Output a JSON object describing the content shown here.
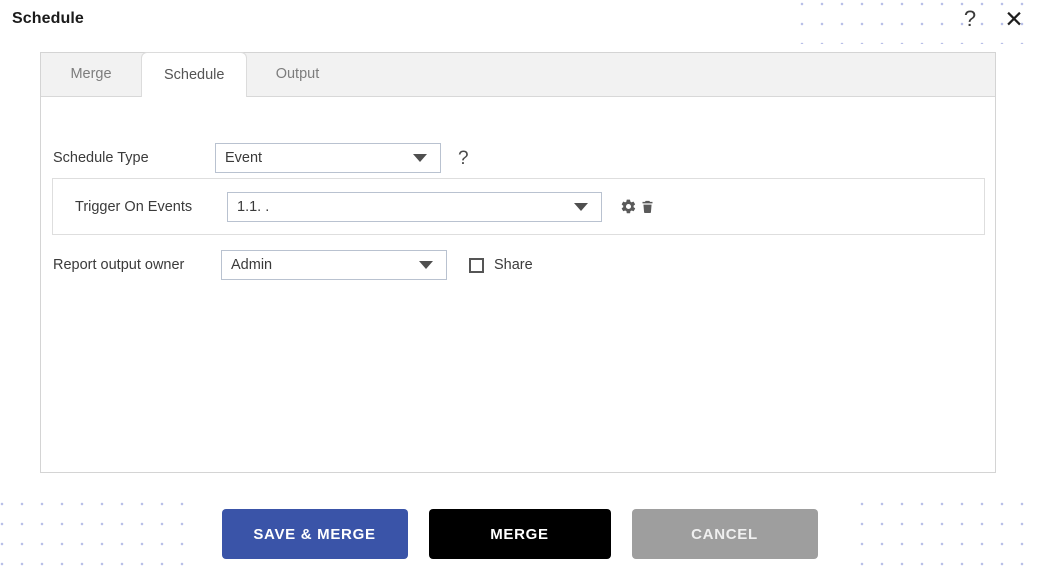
{
  "dialog": {
    "title": "Schedule",
    "help_icon": "question-mark-icon",
    "close_icon": "close-x-icon",
    "help_glyph": "?",
    "close_glyph": "✕"
  },
  "tabs": [
    {
      "id": "merge",
      "label": "Merge",
      "active": false
    },
    {
      "id": "schedule",
      "label": "Schedule",
      "active": true
    },
    {
      "id": "output",
      "label": "Output",
      "active": false
    }
  ],
  "form": {
    "schedule_type": {
      "label": "Schedule Type",
      "value": "Event",
      "help_glyph": "?"
    },
    "trigger_on_events": {
      "label": "Trigger On Events",
      "value": "1.1. .",
      "settings_icon": "gear-icon",
      "delete_icon": "trash-icon"
    },
    "report_output_owner": {
      "label": "Report output owner",
      "value": "Admin"
    },
    "share": {
      "label": "Share",
      "checked": false
    }
  },
  "footer": {
    "save_and_merge_label": "SAVE & MERGE",
    "merge_label": "MERGE",
    "cancel_label": "CANCEL"
  },
  "colors": {
    "primary_blue": "#3a54a8",
    "merge_black": "#000000",
    "cancel_gray": "#9e9e9e",
    "dot_pattern": "#b9c0e8",
    "tab_strip": "#f2f2f2"
  }
}
